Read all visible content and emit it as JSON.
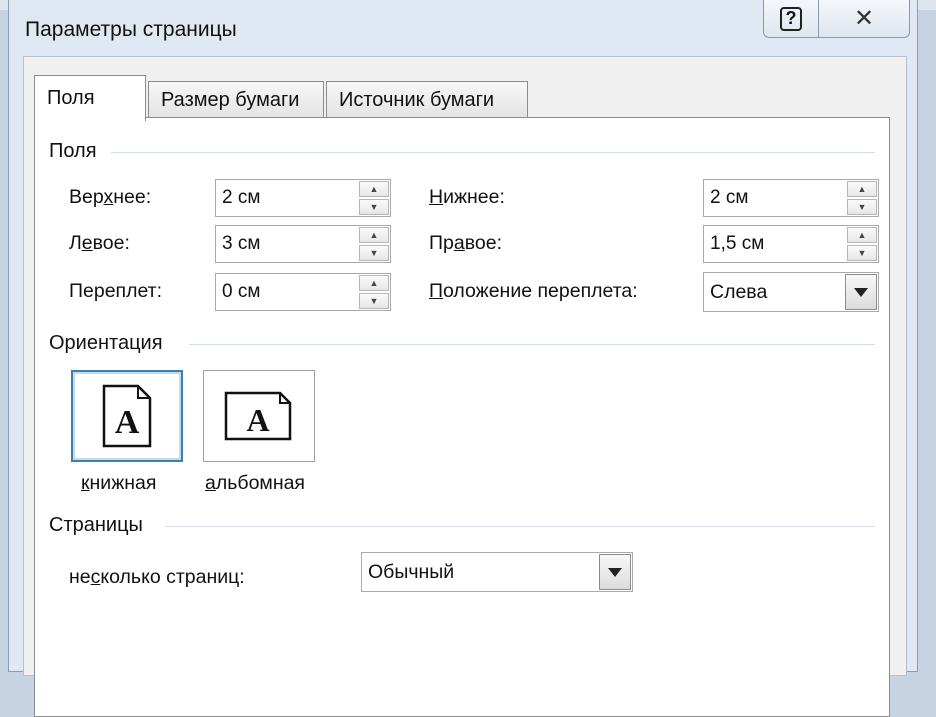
{
  "window": {
    "title": "Параметры страницы"
  },
  "titlebar": {
    "help_label": "?",
    "close_label": "✕"
  },
  "tabs": [
    {
      "label": "Поля",
      "active": true
    },
    {
      "label": "Размер бумаги",
      "active": false
    },
    {
      "label": "Источник бумаги",
      "active": false
    }
  ],
  "margins": {
    "section_title": "Поля",
    "top": {
      "label_a": "Вер",
      "label_u": "х",
      "label_b": "нее:",
      "value": "2 см"
    },
    "bottom": {
      "label_a": "",
      "label_u": "Н",
      "label_b": "ижнее:",
      "value": "2 см"
    },
    "left": {
      "label_a": "Л",
      "label_u": "е",
      "label_b": "вое:",
      "value": "3 см"
    },
    "right": {
      "label_a": "Пр",
      "label_u": "а",
      "label_b": "вое:",
      "value": "1,5 см"
    },
    "gutter": {
      "label_a": "Переплет",
      "label_u": "",
      "label_b": ":",
      "value": "0 см"
    },
    "gutter_position": {
      "label_a": "",
      "label_u": "П",
      "label_b": "оложение переплета:",
      "value": "Слева"
    }
  },
  "orientation": {
    "section_title": "Ориентация",
    "portrait": {
      "label_a": "",
      "label_u": "к",
      "label_b": "нижная",
      "glyph": "A",
      "selected": true
    },
    "landscape": {
      "label_a": "",
      "label_u": "а",
      "label_b": "льбомная",
      "glyph": "A",
      "selected": false
    }
  },
  "pages": {
    "section_title": "Страницы",
    "multiple": {
      "label_a": "не",
      "label_u": "с",
      "label_b": "колько страниц:",
      "value": "Обычный"
    }
  },
  "colors": {
    "accent_border": "#3c7fb1",
    "window_frame": "#dfe8f3"
  },
  "icons": {
    "help": "help-icon",
    "close": "close-icon",
    "spin_up": "spin-up-icon",
    "spin_down": "spin-down-icon",
    "dropdown": "chevron-down-icon",
    "page": "page-icon"
  }
}
